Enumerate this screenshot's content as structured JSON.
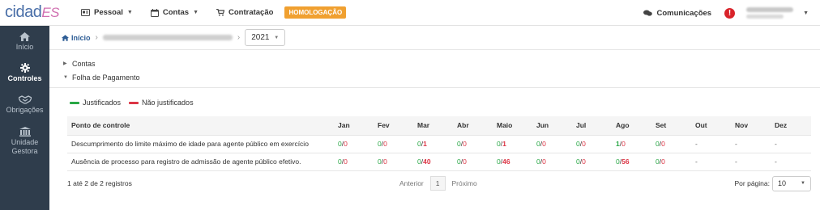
{
  "app": {
    "logo_part1": "cidad",
    "logo_part2": "ES"
  },
  "topnav": {
    "items": [
      {
        "label": "Pessoal",
        "icon": "id-card-icon",
        "dropdown": true
      },
      {
        "label": "Contas",
        "icon": "calendar-icon",
        "dropdown": true
      },
      {
        "label": "Contratação",
        "icon": "cart-icon",
        "dropdown": false
      }
    ],
    "env_badge": "HOMOLOGAÇÃO",
    "comunicacoes": "Comunicações"
  },
  "sidebar": {
    "items": [
      {
        "label": "Início",
        "icon": "home-icon",
        "active": false
      },
      {
        "label": "Controles",
        "icon": "gear-icon",
        "active": true
      },
      {
        "label": "Obrigações",
        "icon": "handshake-icon",
        "active": false
      },
      {
        "label_line1": "Unidade",
        "label_line2": "Gestora",
        "icon": "institution-icon",
        "active": false
      }
    ]
  },
  "breadcrumb": {
    "home": "Início",
    "year": "2021"
  },
  "tree": {
    "items": [
      {
        "label": "Contas",
        "expanded": false
      },
      {
        "label": "Folha de Pagamento",
        "expanded": true
      }
    ]
  },
  "legend": {
    "justified": "Justificados",
    "justified_color": "#28a745",
    "not_justified": "Não justificados",
    "not_justified_color": "#dc3545"
  },
  "table": {
    "headers": [
      "Ponto de controle",
      "Jan",
      "Fev",
      "Mar",
      "Abr",
      "Maio",
      "Jun",
      "Jul",
      "Ago",
      "Set",
      "Out",
      "Nov",
      "Dez"
    ],
    "rows": [
      {
        "name": "Descumprimento do limite máximo de idade para agente público em exercício",
        "months": [
          {
            "j": "0",
            "n": "0"
          },
          {
            "j": "0",
            "n": "0"
          },
          {
            "j": "0",
            "n": "1"
          },
          {
            "j": "0",
            "n": "0"
          },
          {
            "j": "0",
            "n": "1"
          },
          {
            "j": "0",
            "n": "0"
          },
          {
            "j": "0",
            "n": "0"
          },
          {
            "j": "1",
            "n": "0"
          },
          {
            "j": "0",
            "n": "0"
          },
          {
            "dash": "-"
          },
          {
            "dash": "-"
          },
          {
            "dash": "-"
          }
        ]
      },
      {
        "name": "Ausência de processo para registro de admissão de agente público efetivo.",
        "months": [
          {
            "j": "0",
            "n": "0"
          },
          {
            "j": "0",
            "n": "0"
          },
          {
            "j": "0",
            "n": "40"
          },
          {
            "j": "0",
            "n": "0"
          },
          {
            "j": "0",
            "n": "46"
          },
          {
            "j": "0",
            "n": "0"
          },
          {
            "j": "0",
            "n": "0"
          },
          {
            "j": "0",
            "n": "56"
          },
          {
            "j": "0",
            "n": "0"
          },
          {
            "dash": "-"
          },
          {
            "dash": "-"
          },
          {
            "dash": "-"
          }
        ]
      }
    ]
  },
  "footer": {
    "summary": "1 até 2 de 2 registros",
    "prev": "Anterior",
    "page": "1",
    "next": "Próximo",
    "per_page_label": "Por página:",
    "per_page_value": "10"
  }
}
